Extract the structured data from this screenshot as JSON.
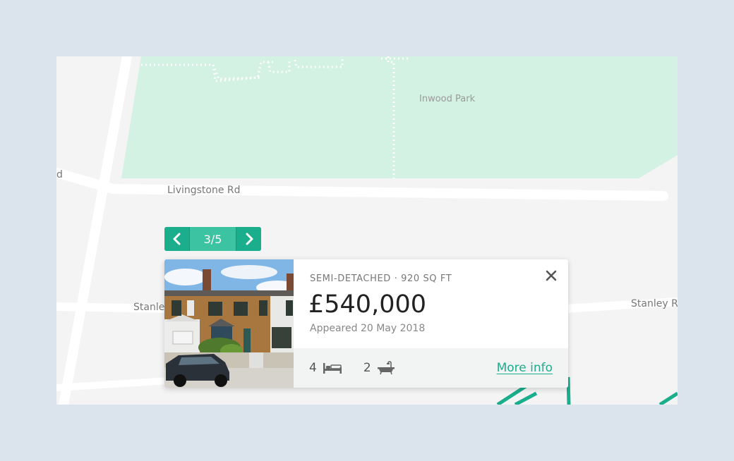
{
  "map": {
    "labels": {
      "park": "Inwood Park",
      "road_livingstone": "Livingstone Rd",
      "road_stanley_left": "Stanle",
      "road_stanley_right": "Stanley R",
      "road_edge_left": "d"
    },
    "colors": {
      "background": "#f4f4f4",
      "park": "#d3f2e3",
      "road": "#ffffff",
      "route": "#1aae8c"
    }
  },
  "pager": {
    "count": "3/5",
    "prev_icon": "chevron-left-icon",
    "next_icon": "chevron-right-icon"
  },
  "listing": {
    "meta": "SEMI-DETACHED · 920 SQ FT",
    "price": "£540,000",
    "appeared": "Appeared 20 May 2018",
    "beds": "4",
    "beds_icon": "bed-icon",
    "baths": "2",
    "baths_icon": "bathtub-icon",
    "more_info": "More info",
    "close_icon": "close-icon"
  },
  "colors": {
    "accent": "#1aae8c",
    "page_background": "#dbe3ed"
  }
}
